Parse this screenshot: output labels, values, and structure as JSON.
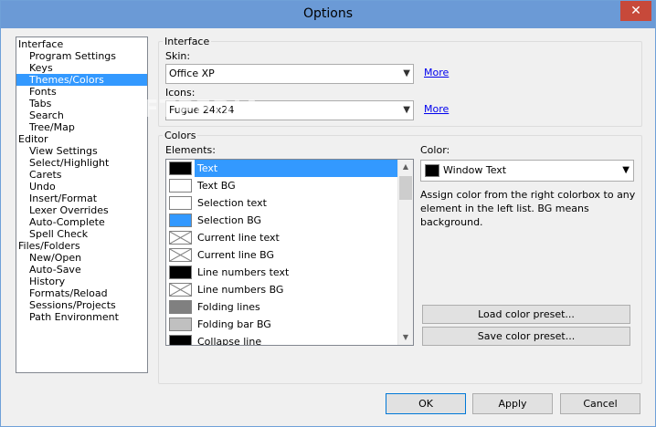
{
  "window": {
    "title": "Options",
    "close_glyph": "✕",
    "watermark": "SOFTPEDIA"
  },
  "tree": {
    "items": [
      {
        "label": "Interface",
        "level": 0
      },
      {
        "label": "Program Settings",
        "level": 1
      },
      {
        "label": "Keys",
        "level": 1
      },
      {
        "label": "Themes/Colors",
        "level": 1,
        "selected": true
      },
      {
        "label": "Fonts",
        "level": 1
      },
      {
        "label": "Tabs",
        "level": 1
      },
      {
        "label": "Search",
        "level": 1
      },
      {
        "label": "Tree/Map",
        "level": 1
      },
      {
        "label": "Editor",
        "level": 0
      },
      {
        "label": "View Settings",
        "level": 1
      },
      {
        "label": "Select/Highlight",
        "level": 1
      },
      {
        "label": "Carets",
        "level": 1
      },
      {
        "label": "Undo",
        "level": 1
      },
      {
        "label": "Insert/Format",
        "level": 1
      },
      {
        "label": "Lexer Overrides",
        "level": 1
      },
      {
        "label": "Auto-Complete",
        "level": 1
      },
      {
        "label": "Spell Check",
        "level": 1
      },
      {
        "label": "Files/Folders",
        "level": 0
      },
      {
        "label": "New/Open",
        "level": 1
      },
      {
        "label": "Auto-Save",
        "level": 1
      },
      {
        "label": "History",
        "level": 1
      },
      {
        "label": "Formats/Reload",
        "level": 1
      },
      {
        "label": "Sessions/Projects",
        "level": 1
      },
      {
        "label": "Path Environment",
        "level": 1
      }
    ]
  },
  "interface_group": {
    "title": "Interface",
    "skin_label": "Skin:",
    "skin_value": "Office XP",
    "skin_more": "More",
    "icons_label": "Icons:",
    "icons_value": "Fugue 24x24",
    "icons_more": "More"
  },
  "colors_group": {
    "title": "Colors",
    "elements_label": "Elements:",
    "color_label": "Color:",
    "color_value": "Window Text",
    "color_value_hex": "#000000",
    "description": "Assign color from the right colorbox to any element in the left list. BG means background.",
    "load_preset": "Load color preset...",
    "save_preset": "Save color preset..."
  },
  "elements": [
    {
      "name": "Text",
      "color": "#000000",
      "selected": true
    },
    {
      "name": "Text BG",
      "color": "#ffffff"
    },
    {
      "name": "Selection text",
      "color": "#ffffff"
    },
    {
      "name": "Selection BG",
      "color": "#3399ff"
    },
    {
      "name": "Current line text",
      "color": null
    },
    {
      "name": "Current line BG",
      "color": null
    },
    {
      "name": "Line numbers text",
      "color": "#000000"
    },
    {
      "name": "Line numbers BG",
      "color": null
    },
    {
      "name": "Folding lines",
      "color": "#808080"
    },
    {
      "name": "Folding bar BG",
      "color": "#c0c0c0"
    },
    {
      "name": "Collapse line",
      "color": "#000000"
    }
  ],
  "buttons": {
    "ok": "OK",
    "apply": "Apply",
    "cancel": "Cancel"
  },
  "icons": {
    "close": "close-icon",
    "dropdown": "chevron-down-icon",
    "scroll_up": "arrow-up-icon",
    "scroll_down": "arrow-down-icon"
  }
}
